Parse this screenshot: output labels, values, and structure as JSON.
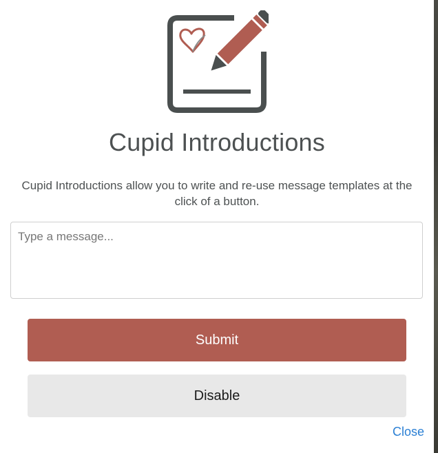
{
  "dialog": {
    "title": "Cupid Introductions",
    "description": "Cupid Introductions allow you to write and re-use message templates at the click of a button.",
    "message_input": {
      "value": "",
      "placeholder": "Type a message..."
    },
    "submit_label": "Submit",
    "disable_label": "Disable",
    "close_label": "Close",
    "icon": "edit-note-heart-icon"
  },
  "colors": {
    "accent": "#b05d52",
    "text": "#4d5152",
    "icon_frame": "#4a4f4f",
    "secondary_button": "#e8e8e8",
    "link": "#2a7fd4"
  }
}
